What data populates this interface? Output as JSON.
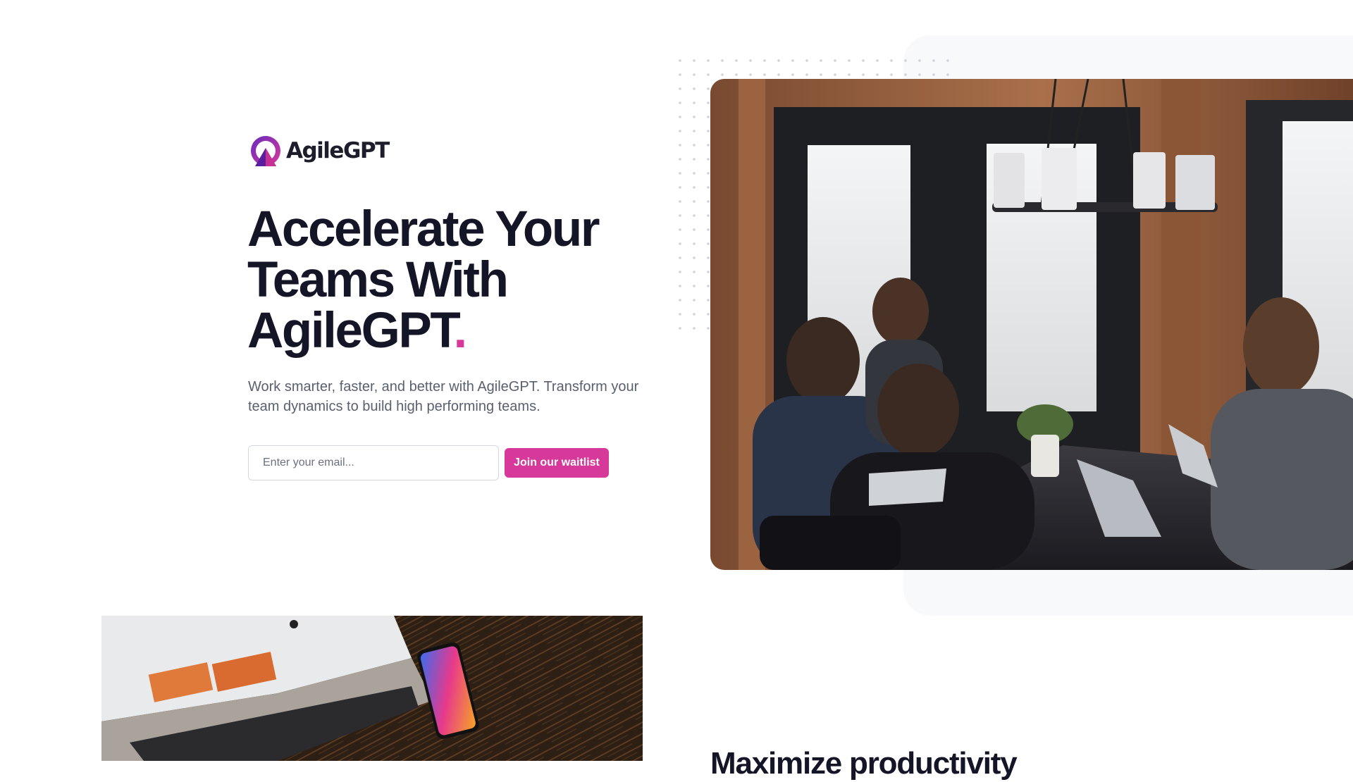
{
  "brand": {
    "name": "AgileGPT",
    "colors": {
      "primary": "#d6399a",
      "logo_purple": "#6a2bbf",
      "heading": "#151528",
      "body_text": "#5a6070"
    }
  },
  "hero": {
    "headline_lines": [
      "Accelerate Your",
      "Teams With",
      "AgileGPT"
    ],
    "headline_accent": ".",
    "subtext": "Work smarter, faster, and better with AgileGPT. Transform your team dynamics to build high performing teams.",
    "email_placeholder": "Enter your email...",
    "email_value": "",
    "cta_label": "Join our waitlist",
    "image_subject": "team-meeting-photo"
  },
  "feature": {
    "image_subject": "laptop-and-phone-photo",
    "heading": "Maximize productivity"
  },
  "icons": {
    "logo": "agilegpt-logo-icon"
  }
}
